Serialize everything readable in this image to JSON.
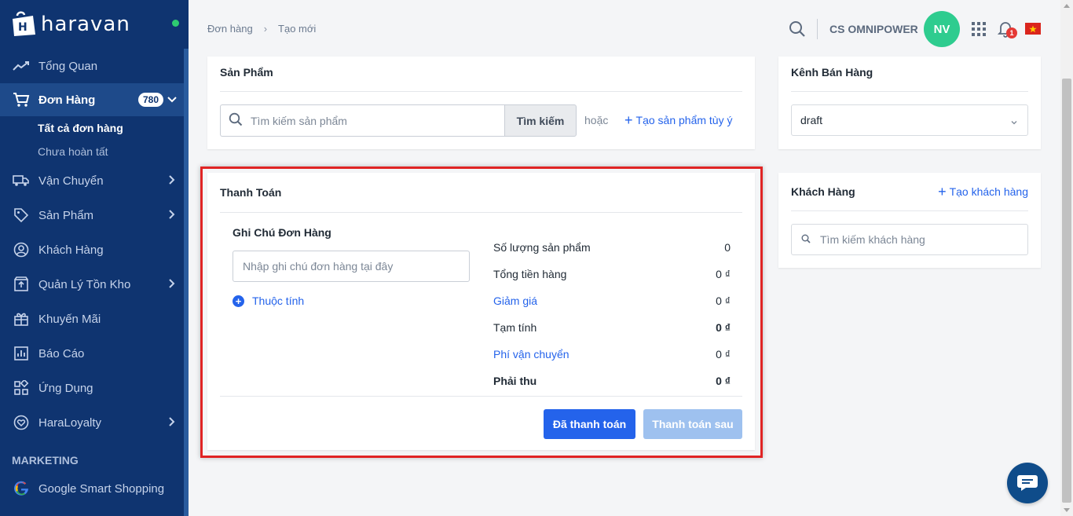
{
  "brand": {
    "name": "haravan"
  },
  "sidebar": {
    "items": [
      {
        "label": "Tổng Quan",
        "icon": "trend-icon"
      },
      {
        "label": "Đơn Hàng",
        "icon": "cart-icon",
        "badge": "780"
      },
      {
        "label": "Vận Chuyển",
        "icon": "truck-icon"
      },
      {
        "label": "Sản Phẩm",
        "icon": "tag-icon"
      },
      {
        "label": "Khách Hàng",
        "icon": "user-icon"
      },
      {
        "label": "Quản Lý Tồn Kho",
        "icon": "inventory-icon"
      },
      {
        "label": "Khuyến Mãi",
        "icon": "gift-icon"
      },
      {
        "label": "Báo Cáo",
        "icon": "report-icon"
      },
      {
        "label": "Ứng Dụng",
        "icon": "apps-icon"
      },
      {
        "label": "HaraLoyalty",
        "icon": "heart-icon"
      }
    ],
    "sub_items": [
      "Tất cả đơn hàng",
      "Chưa hoàn tất"
    ],
    "marketing_title": "MARKETING",
    "marketing_items": [
      {
        "label": "Google Smart Shopping",
        "icon": "google-icon"
      }
    ]
  },
  "header": {
    "breadcrumb": [
      "Đơn hàng",
      "Tạo mới"
    ],
    "store_name": "CS OMNIPOWER",
    "avatar_initials": "NV",
    "notification_count": "1"
  },
  "products": {
    "title": "Sản Phẩm",
    "search_placeholder": "Tìm kiếm sản phẩm",
    "search_button": "Tìm kiếm",
    "or_text": "hoặc",
    "create_link": "Tạo sản phẩm tùy ý"
  },
  "payment": {
    "title": "Thanh Toán",
    "note_title": "Ghi Chú Đơn Hàng",
    "note_placeholder": "Nhập ghi chú đơn hàng tại đây",
    "attribute_link": "Thuộc tính",
    "summary": [
      {
        "label": "Số lượng sản phẩm",
        "value": "0"
      },
      {
        "label": "Tổng tiền hàng",
        "value": "0 ₫"
      },
      {
        "label": "Giảm giá",
        "value": "0 ₫"
      },
      {
        "label": "Tạm tính",
        "value": "0 ₫"
      },
      {
        "label": "Phí vận chuyển",
        "value": "0 ₫"
      },
      {
        "label": "Phải thu",
        "value": "0 ₫"
      }
    ],
    "paid_button": "Đã thanh toán",
    "pay_later_button": "Thanh toán sau"
  },
  "channel": {
    "title": "Kênh Bán Hàng",
    "selected": "draft"
  },
  "customer": {
    "title": "Khách Hàng",
    "create_link": "Tạo khách hàng",
    "search_placeholder": "Tìm kiếm khách hàng"
  },
  "colors": {
    "sidebar_bg": "#0f3470",
    "accent": "#2463eb",
    "highlight": "#e02424"
  }
}
